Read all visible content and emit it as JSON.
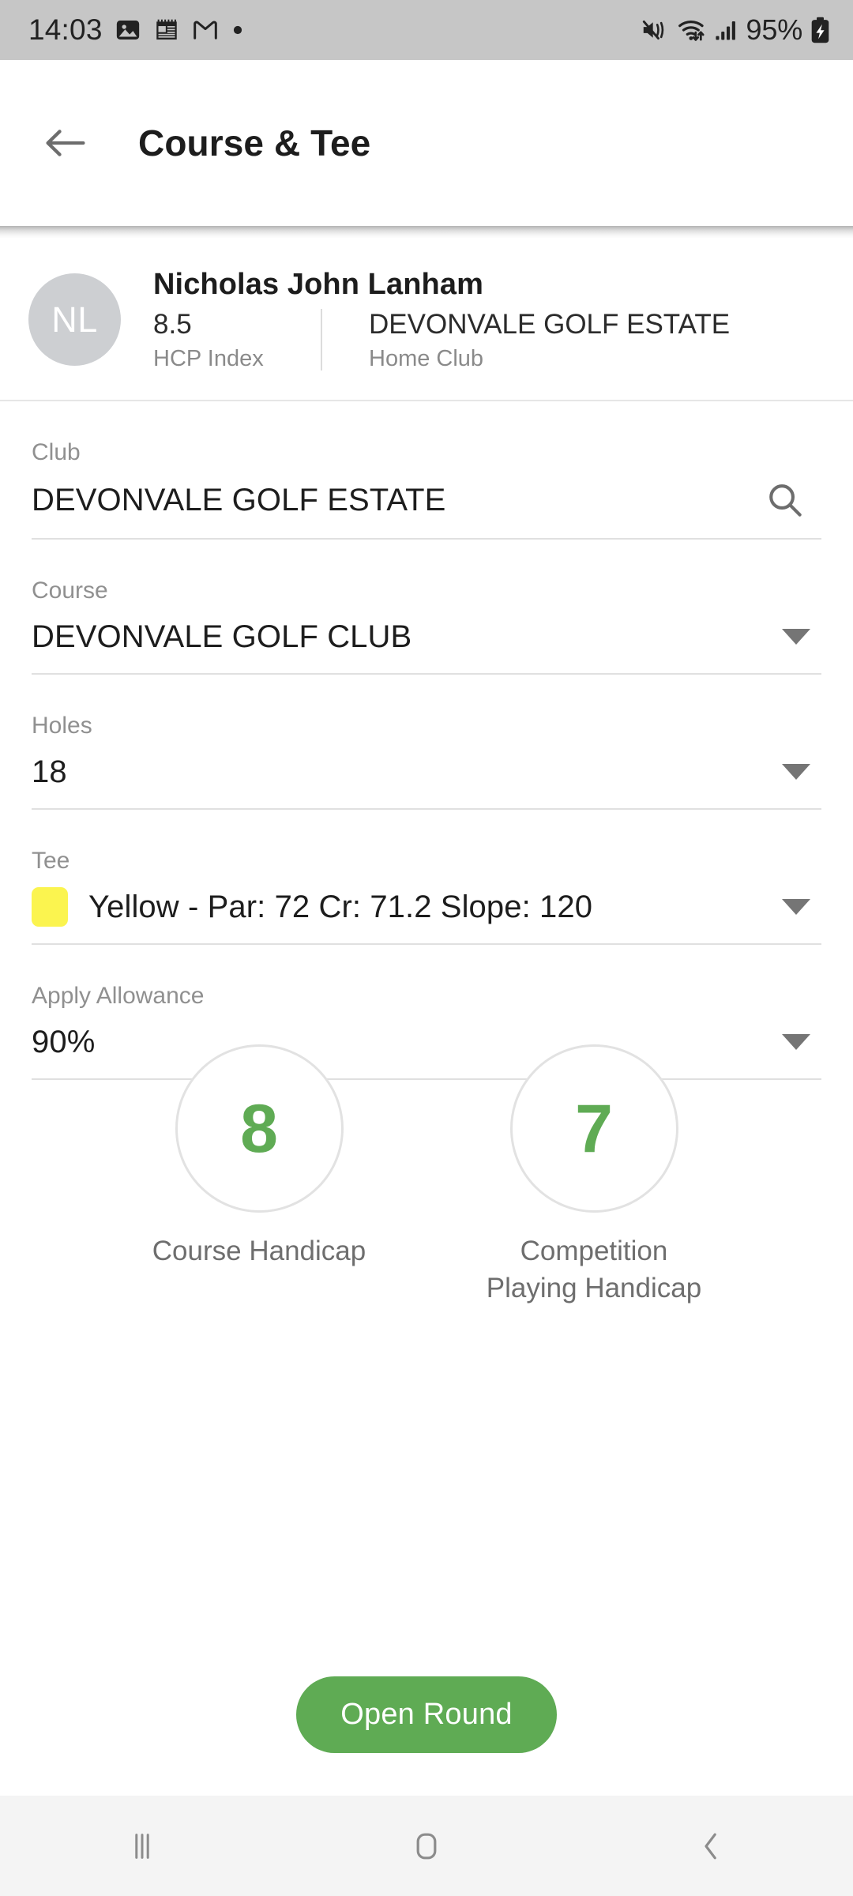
{
  "status_bar": {
    "time": "14:03",
    "battery_percent": "95%",
    "left_icons": [
      "gallery-icon",
      "calendar-icon",
      "gmail-icon",
      "notification-dot-icon"
    ],
    "right_icons": [
      "mute-vibrate-icon",
      "wifi-icon",
      "signal-bars-icon",
      "battery-charging-icon"
    ],
    "background_color": "#c6c6c6"
  },
  "app_bar": {
    "back_icon": "back-arrow-icon",
    "title": "Course & Tee"
  },
  "profile": {
    "avatar_initials": "NL",
    "name": "Nicholas John Lanham",
    "hcp_index_value": "8.5",
    "hcp_index_label": "HCP Index",
    "home_club_value": "DEVONVALE GOLF ESTATE",
    "home_club_label": "Home Club"
  },
  "form": {
    "club": {
      "label": "Club",
      "value": "DEVONVALE GOLF ESTATE",
      "icon": "search-icon"
    },
    "course": {
      "label": "Course",
      "value": "DEVONVALE GOLF CLUB",
      "icon": "chevron-down-icon"
    },
    "holes": {
      "label": "Holes",
      "value": "18",
      "icon": "chevron-down-icon"
    },
    "tee": {
      "label": "Tee",
      "value": "Yellow - Par: 72 Cr: 71.2 Slope: 120",
      "swatch_color": "#fbf44f",
      "icon": "chevron-down-icon"
    },
    "allowance": {
      "label": "Apply Allowance",
      "value": "90%",
      "icon": "chevron-down-icon"
    }
  },
  "handicaps": [
    {
      "value": "8",
      "label": "Course Handicap"
    },
    {
      "value": "7",
      "label": "Competition Playing Handicap"
    }
  ],
  "actions": {
    "open_round_label": "Open Round"
  },
  "nav_bar": {
    "recents_icon": "recents-icon",
    "home_icon": "home-icon",
    "back_icon": "back-chevron-icon"
  },
  "colors": {
    "accent_green": "#5fab54",
    "tee_yellow": "#fbf44f",
    "status_gray": "#c6c6c6"
  }
}
